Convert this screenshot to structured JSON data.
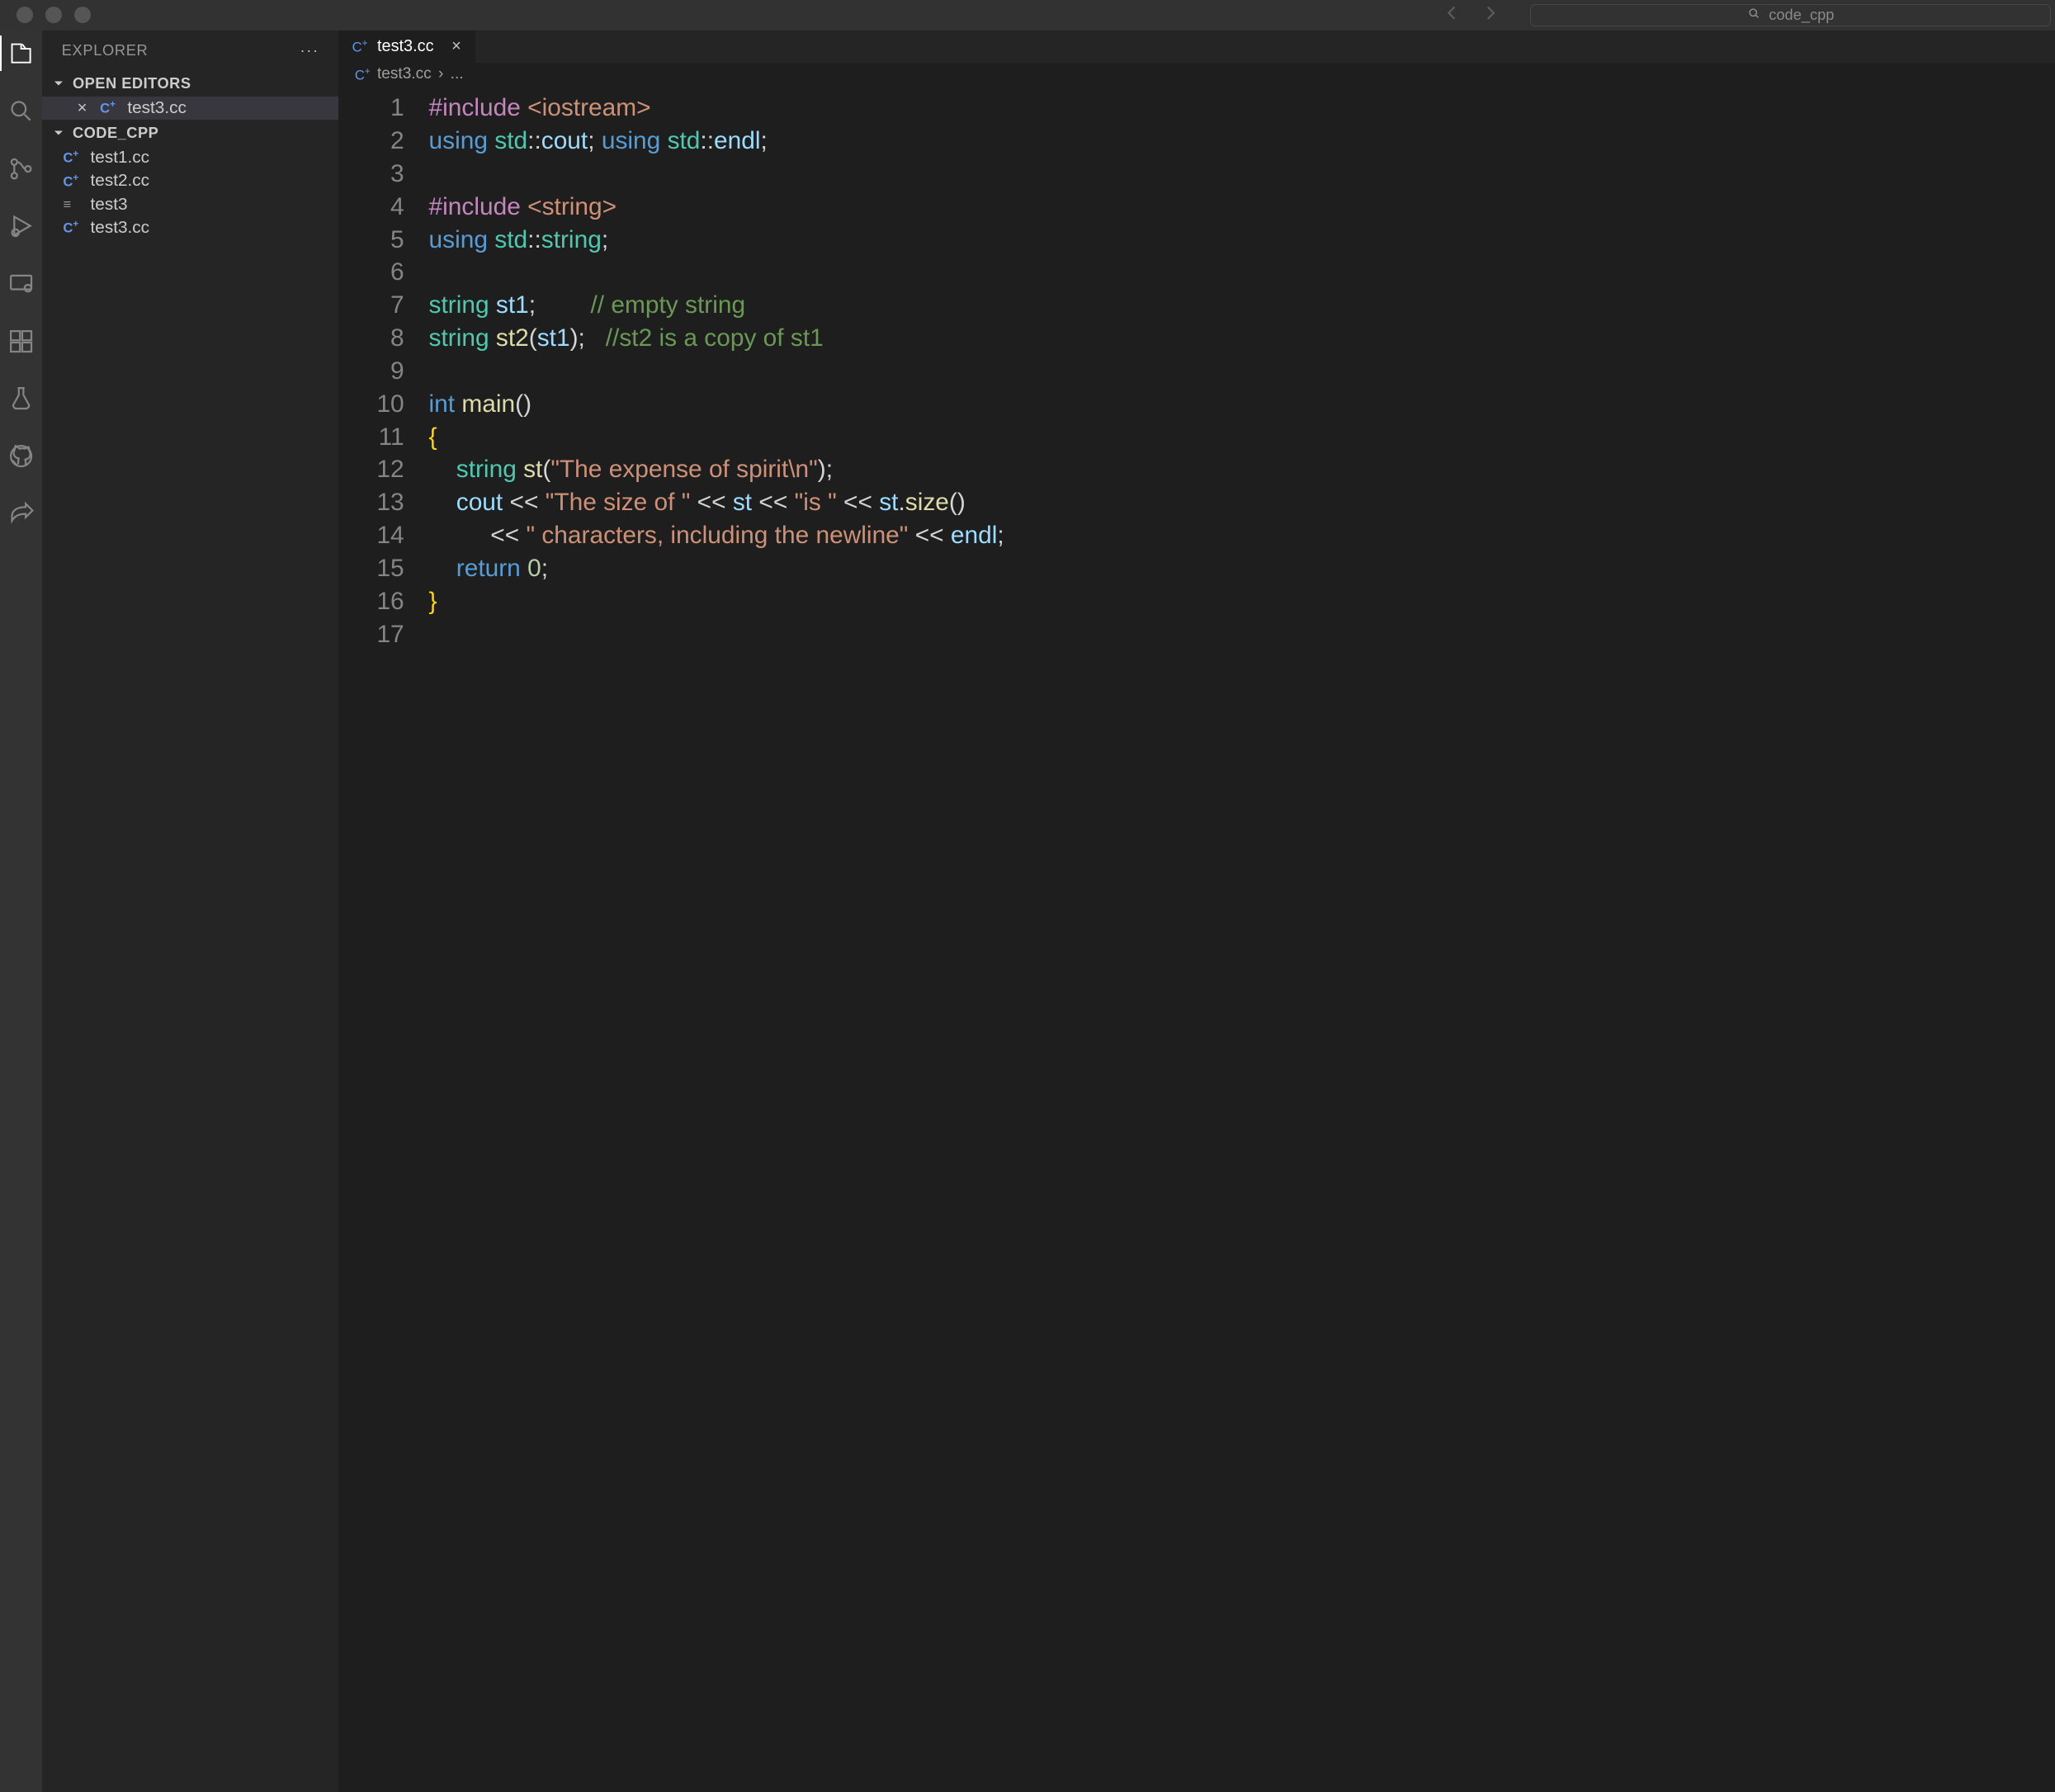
{
  "titlebar": {
    "search_placeholder": "code_cpp"
  },
  "sidebar": {
    "title": "EXPLORER",
    "sections": {
      "open_editors_label": "OPEN EDITORS",
      "workspace_label": "CODE_CPP"
    },
    "open_editors": [
      {
        "name": "test3.cc",
        "icon": "cpp"
      }
    ],
    "files": [
      {
        "name": "test1.cc",
        "icon": "cpp"
      },
      {
        "name": "test2.cc",
        "icon": "cpp"
      },
      {
        "name": "test3",
        "icon": "plain"
      },
      {
        "name": "test3.cc",
        "icon": "cpp"
      }
    ]
  },
  "tabs": {
    "active": {
      "name": "test3.cc",
      "icon": "cpp"
    }
  },
  "breadcrumb": {
    "file": "test3.cc",
    "ellipsis": "..."
  },
  "editor": {
    "lines": [
      {
        "n": 1,
        "tokens": [
          {
            "c": "tk-preproc",
            "t": "#include "
          },
          {
            "c": "tk-str",
            "t": "<iostream>"
          }
        ]
      },
      {
        "n": 2,
        "tokens": [
          {
            "c": "tk-kw",
            "t": "using "
          },
          {
            "c": "tk-ns",
            "t": "std"
          },
          {
            "c": "tk-punc",
            "t": "::"
          },
          {
            "c": "tk-var",
            "t": "cout"
          },
          {
            "c": "tk-punc",
            "t": "; "
          },
          {
            "c": "tk-kw",
            "t": "using "
          },
          {
            "c": "tk-ns",
            "t": "std"
          },
          {
            "c": "tk-punc",
            "t": "::"
          },
          {
            "c": "tk-var",
            "t": "endl"
          },
          {
            "c": "tk-punc",
            "t": ";"
          }
        ]
      },
      {
        "n": 3,
        "tokens": []
      },
      {
        "n": 4,
        "tokens": [
          {
            "c": "tk-preproc",
            "t": "#include "
          },
          {
            "c": "tk-str",
            "t": "<string>"
          }
        ]
      },
      {
        "n": 5,
        "tokens": [
          {
            "c": "tk-kw",
            "t": "using "
          },
          {
            "c": "tk-ns",
            "t": "std"
          },
          {
            "c": "tk-punc",
            "t": "::"
          },
          {
            "c": "tk-type",
            "t": "string"
          },
          {
            "c": "tk-punc",
            "t": ";"
          }
        ]
      },
      {
        "n": 6,
        "tokens": []
      },
      {
        "n": 7,
        "tokens": [
          {
            "c": "tk-type",
            "t": "string "
          },
          {
            "c": "tk-var",
            "t": "st1"
          },
          {
            "c": "tk-punc",
            "t": ";        "
          },
          {
            "c": "tk-comment",
            "t": "// empty string"
          }
        ]
      },
      {
        "n": 8,
        "tokens": [
          {
            "c": "tk-type",
            "t": "string "
          },
          {
            "c": "tk-fn",
            "t": "st2"
          },
          {
            "c": "tk-punc",
            "t": "("
          },
          {
            "c": "tk-var",
            "t": "st1"
          },
          {
            "c": "tk-punc",
            "t": ");   "
          },
          {
            "c": "tk-comment",
            "t": "//st2 is a copy of st1"
          }
        ]
      },
      {
        "n": 9,
        "tokens": []
      },
      {
        "n": 10,
        "tokens": [
          {
            "c": "tk-kw",
            "t": "int "
          },
          {
            "c": "tk-fn",
            "t": "main"
          },
          {
            "c": "tk-punc",
            "t": "()"
          }
        ]
      },
      {
        "n": 11,
        "tokens": [
          {
            "c": "tk-brace",
            "t": "{"
          }
        ]
      },
      {
        "n": 12,
        "tokens": [
          {
            "c": "indent-guide",
            "t": "    "
          },
          {
            "c": "tk-type",
            "t": "string "
          },
          {
            "c": "tk-fn",
            "t": "st"
          },
          {
            "c": "tk-punc",
            "t": "("
          },
          {
            "c": "tk-str",
            "t": "\"The expense of spirit\\n\""
          },
          {
            "c": "tk-punc",
            "t": ");"
          }
        ]
      },
      {
        "n": 13,
        "tokens": [
          {
            "c": "indent-guide",
            "t": "    "
          },
          {
            "c": "tk-var",
            "t": "cout"
          },
          {
            "c": "tk-punc",
            "t": " << "
          },
          {
            "c": "tk-str",
            "t": "\"The size of \""
          },
          {
            "c": "tk-punc",
            "t": " << "
          },
          {
            "c": "tk-var",
            "t": "st"
          },
          {
            "c": "tk-punc",
            "t": " << "
          },
          {
            "c": "tk-str",
            "t": "\"is \""
          },
          {
            "c": "tk-punc",
            "t": " << "
          },
          {
            "c": "tk-var",
            "t": "st"
          },
          {
            "c": "tk-punc",
            "t": "."
          },
          {
            "c": "tk-fn",
            "t": "size"
          },
          {
            "c": "tk-punc",
            "t": "()"
          }
        ]
      },
      {
        "n": 14,
        "tokens": [
          {
            "c": "indent-guide",
            "t": "         "
          },
          {
            "c": "tk-punc",
            "t": "<< "
          },
          {
            "c": "tk-str",
            "t": "\" characters, including the newline\""
          },
          {
            "c": "tk-punc",
            "t": " << "
          },
          {
            "c": "tk-var",
            "t": "endl"
          },
          {
            "c": "tk-punc",
            "t": ";"
          }
        ]
      },
      {
        "n": 15,
        "tokens": [
          {
            "c": "indent-guide",
            "t": "    "
          },
          {
            "c": "tk-kw",
            "t": "return "
          },
          {
            "c": "tk-num",
            "t": "0"
          },
          {
            "c": "tk-punc",
            "t": ";"
          }
        ]
      },
      {
        "n": 16,
        "tokens": [
          {
            "c": "tk-brace",
            "t": "}"
          }
        ]
      },
      {
        "n": 17,
        "tokens": []
      }
    ]
  }
}
